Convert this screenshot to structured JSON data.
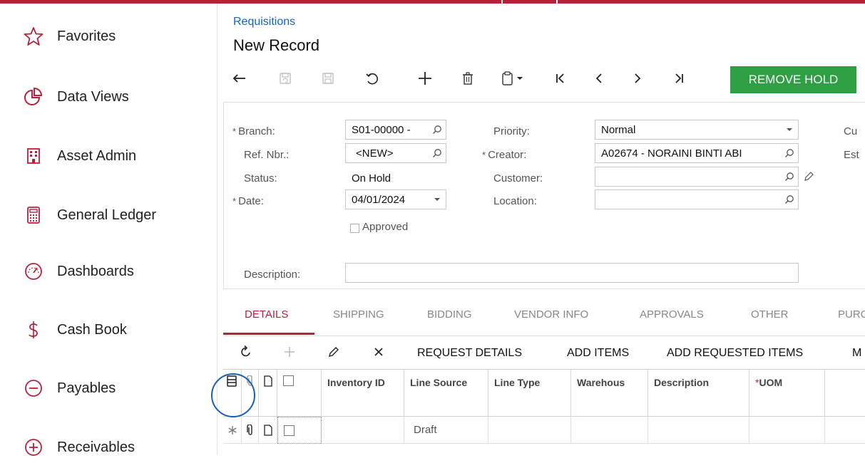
{
  "sidebar": {
    "items": [
      {
        "label": "Favorites",
        "icon": "star-icon"
      },
      {
        "label": "Data Views",
        "icon": "pie-chart-icon"
      },
      {
        "label": "Asset Admin",
        "icon": "building-icon"
      },
      {
        "label": "General Ledger",
        "icon": "calculator-icon"
      },
      {
        "label": "Dashboards",
        "icon": "gauge-icon"
      },
      {
        "label": "Cash Book",
        "icon": "dollar-icon"
      },
      {
        "label": "Payables",
        "icon": "minus-circle-icon"
      },
      {
        "label": "Receivables",
        "icon": "plus-circle-icon"
      }
    ]
  },
  "header": {
    "breadcrumb": "Requisitions",
    "title": "New Record",
    "remove_hold_label": "REMOVE HOLD"
  },
  "form": {
    "branch": {
      "label": "Branch:",
      "value": "S01-00000 -"
    },
    "ref_nbr": {
      "label": "Ref. Nbr.:",
      "value": "<NEW>"
    },
    "status": {
      "label": "Status:",
      "value": "On Hold"
    },
    "date": {
      "label": "Date:",
      "value": "04/01/2024"
    },
    "approved": {
      "label": "Approved"
    },
    "priority": {
      "label": "Priority:",
      "value": "Normal"
    },
    "creator": {
      "label": "Creator:",
      "value": "A02674 - NORAINI BINTI ABI"
    },
    "customer": {
      "label": "Customer:",
      "value": ""
    },
    "location": {
      "label": "Location:",
      "value": ""
    },
    "description": {
      "label": "Description:",
      "value": ""
    },
    "right_cut_1": "Cu",
    "right_cut_2": "Est"
  },
  "tabs": [
    "DETAILS",
    "SHIPPING",
    "BIDDING",
    "VENDOR INFO",
    "APPROVALS",
    "OTHER",
    "PURC"
  ],
  "grid_toolbar": {
    "request_details": "REQUEST DETAILS",
    "add_items": "ADD ITEMS",
    "add_requested_items": "ADD REQUESTED ITEMS",
    "more": "M"
  },
  "grid": {
    "columns": [
      "Inventory ID",
      "Line Source",
      "Line Type",
      "Warehous",
      "Description",
      "UOM"
    ],
    "uom_required_mark": "*",
    "row": {
      "line_source": "Draft"
    }
  },
  "colors": {
    "accent": "#b8213a",
    "link": "#1565c0",
    "hold_button": "#2ea043",
    "highlight_circle": "#1a5fb4"
  }
}
